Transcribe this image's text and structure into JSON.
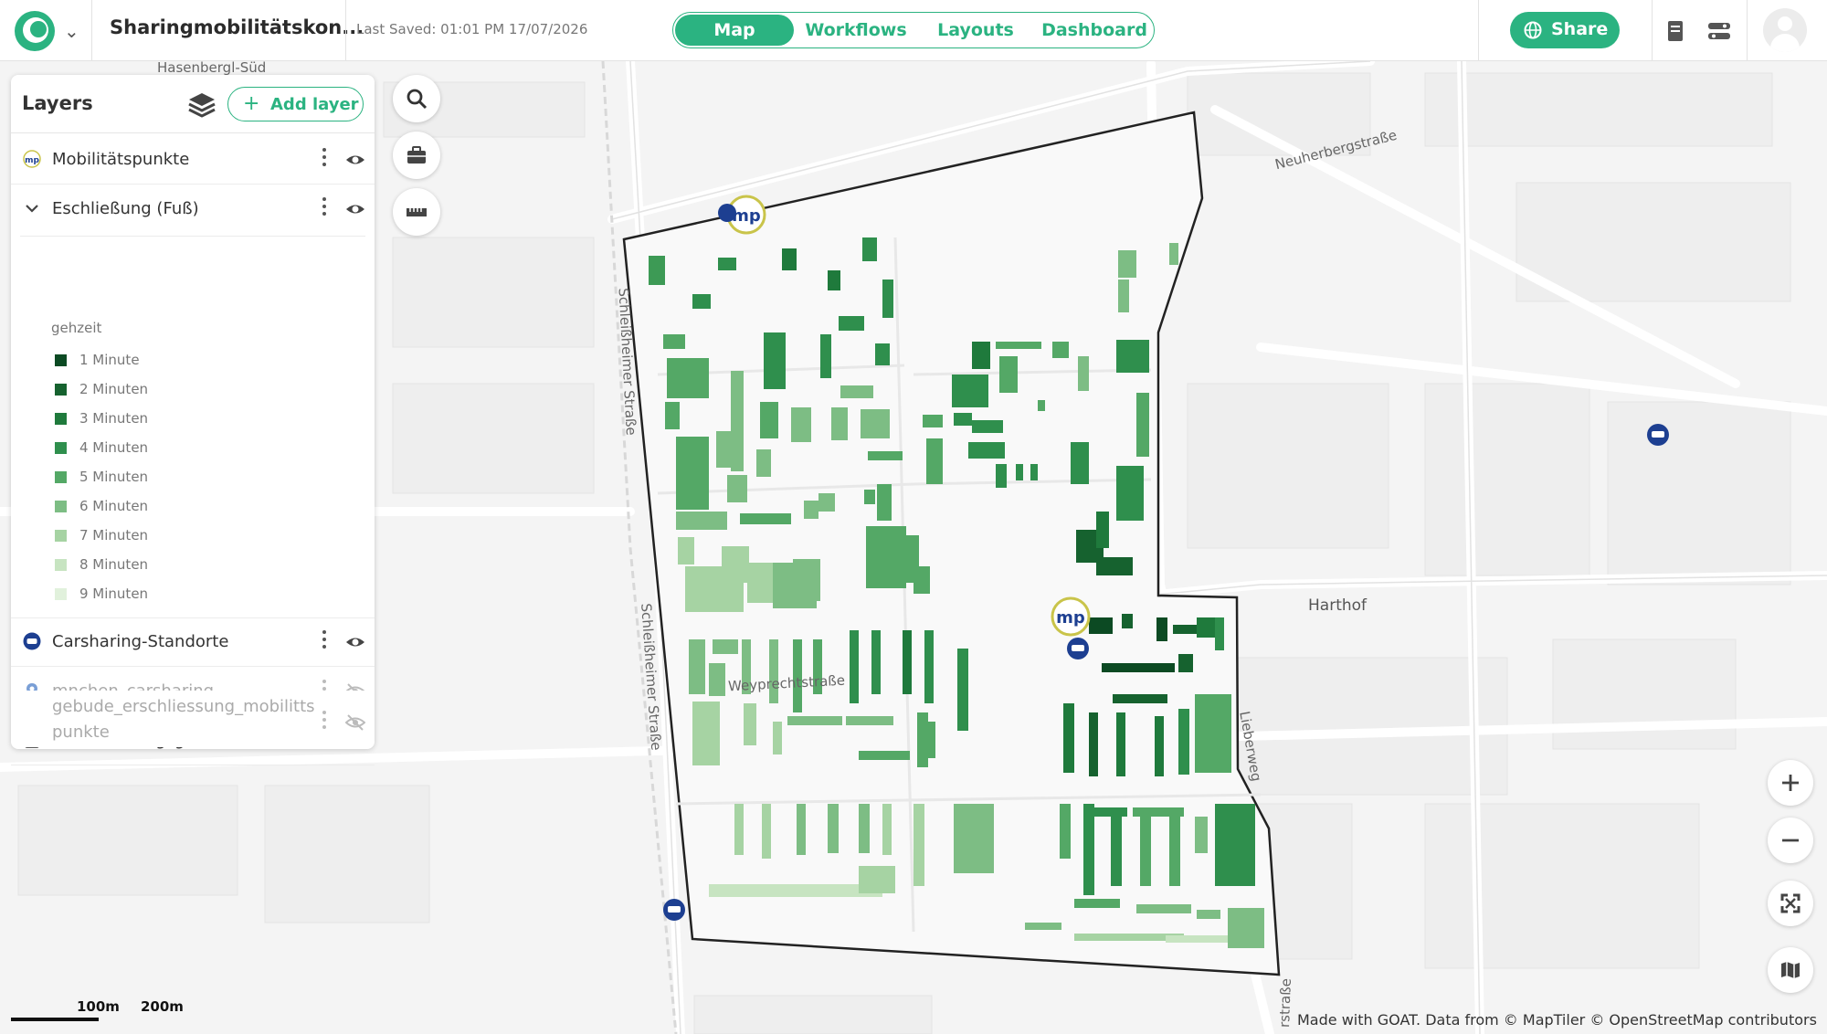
{
  "header": {
    "project_title": "Sharingmobilitätskon...",
    "last_saved": "Last Saved: 01:01 PM 17/07/2026",
    "tabs": [
      {
        "label": "Map",
        "active": true
      },
      {
        "label": "Workflows",
        "active": false
      },
      {
        "label": "Layouts",
        "active": false
      },
      {
        "label": "Dashboard",
        "active": false
      }
    ],
    "share_label": "Share",
    "accent_color": "#2bb381"
  },
  "layers_panel": {
    "title": "Layers",
    "add_layer_label": "Add layer",
    "layers": [
      {
        "name": "Mobilitätspunkte",
        "icon": "mp-logo-icon",
        "visible": true
      },
      {
        "name": "Eschließung (Fuß)",
        "icon": "chevron-down-icon",
        "visible": true,
        "expanded": true
      },
      {
        "name": "Carsharing-Standorte",
        "icon": "carsharing-icon",
        "visible": true
      },
      {
        "name": "mnchen_carsharing",
        "icon": "map-pin-icon",
        "visible": false
      },
      {
        "name": "untersuchungsgebiet",
        "icon": "square-outline-icon",
        "visible": true
      },
      {
        "name": "gebude_erschliessung_mobilitts punkte",
        "icon": "",
        "visible": false
      }
    ],
    "legend": {
      "field": "gehzeit",
      "items": [
        {
          "label": "1 Minute",
          "color": "#0c4a23"
        },
        {
          "label": "2 Minuten",
          "color": "#16622f"
        },
        {
          "label": "3 Minuten",
          "color": "#1f7a3c"
        },
        {
          "label": "4 Minuten",
          "color": "#2f8f4d"
        },
        {
          "label": "5 Minuten",
          "color": "#54a866"
        },
        {
          "label": "6 Minuten",
          "color": "#7dbd84"
        },
        {
          "label": "7 Minuten",
          "color": "#a6d3a3"
        },
        {
          "label": "8 Minuten",
          "color": "#c7e4c1"
        },
        {
          "label": "9 Minuten",
          "color": "#e1f1dc"
        }
      ]
    }
  },
  "map": {
    "street_labels": [
      "Neuherbergstraße",
      "Schleißheimer Straße",
      "Schleißheimer Straße",
      "Weyprechtstraße",
      "Lieberweg",
      "Hasenbergl-Süd",
      "rstraße"
    ],
    "place_labels": [
      "Harthof"
    ],
    "scale": {
      "label_1": "100m",
      "label_2": "200m"
    },
    "attribution": "Made with GOAT. Data from © MapTiler © OpenStreetMap contributors"
  }
}
